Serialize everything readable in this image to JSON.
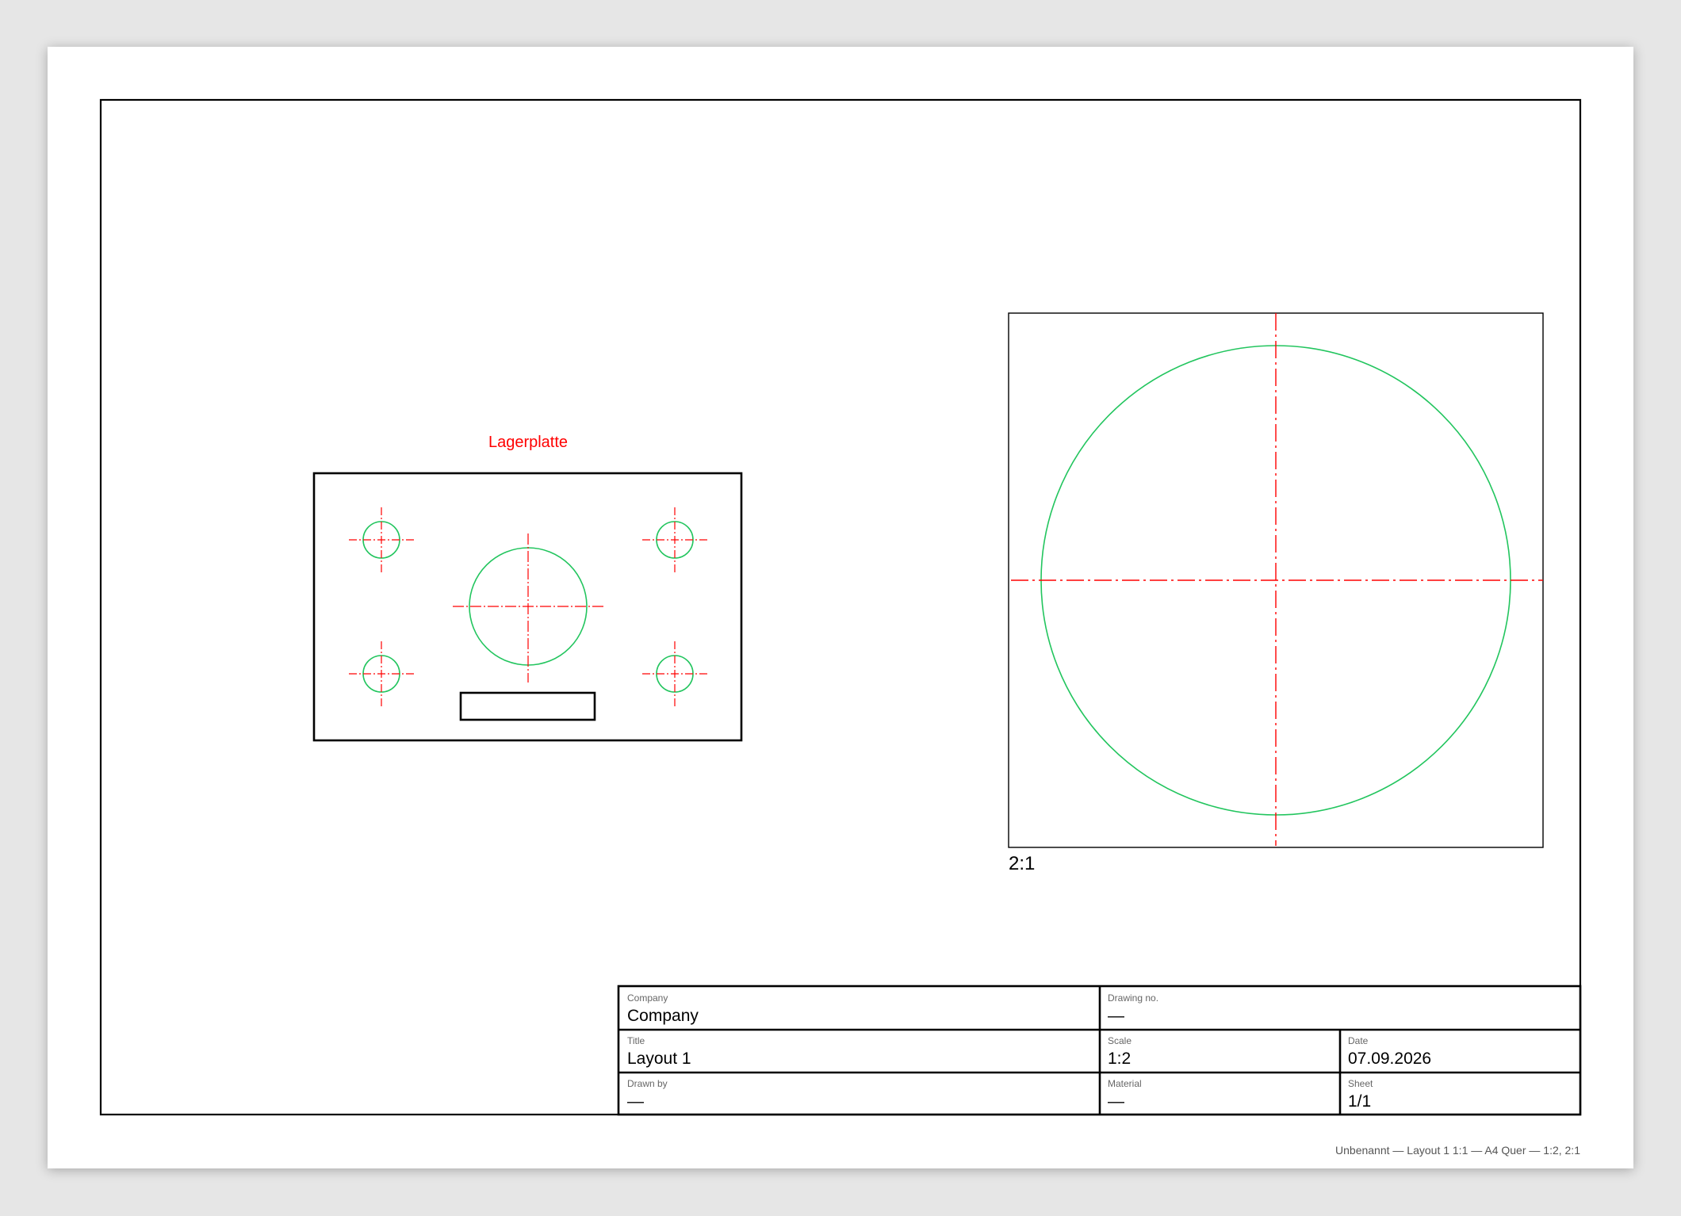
{
  "document": {
    "status_line": "Unbenannt — Layout 1 1:1 — A4 Quer — 1:2, 2:1"
  },
  "views": {
    "main": {
      "title": "Lagerplatte",
      "title_color": "#ff0000"
    },
    "detail": {
      "scale_label": "2:1"
    }
  },
  "colors": {
    "outline": "#000000",
    "circle": "#22c55e",
    "centerline": "#ff0000",
    "paper": "#ffffff",
    "background": "#e6e6e6"
  },
  "title_block": {
    "company": {
      "label": "Company",
      "value": "Company"
    },
    "drawing_no": {
      "label": "Drawing no.",
      "value": "—"
    },
    "title": {
      "label": "Title",
      "value": "Layout 1"
    },
    "scale": {
      "label": "Scale",
      "value": "1:2"
    },
    "date": {
      "label": "Date",
      "value": "07.09.2026"
    },
    "drawn_by": {
      "label": "Drawn by",
      "value": "—"
    },
    "material": {
      "label": "Material",
      "value": "—"
    },
    "sheet": {
      "label": "Sheet",
      "value": "1/1"
    }
  }
}
